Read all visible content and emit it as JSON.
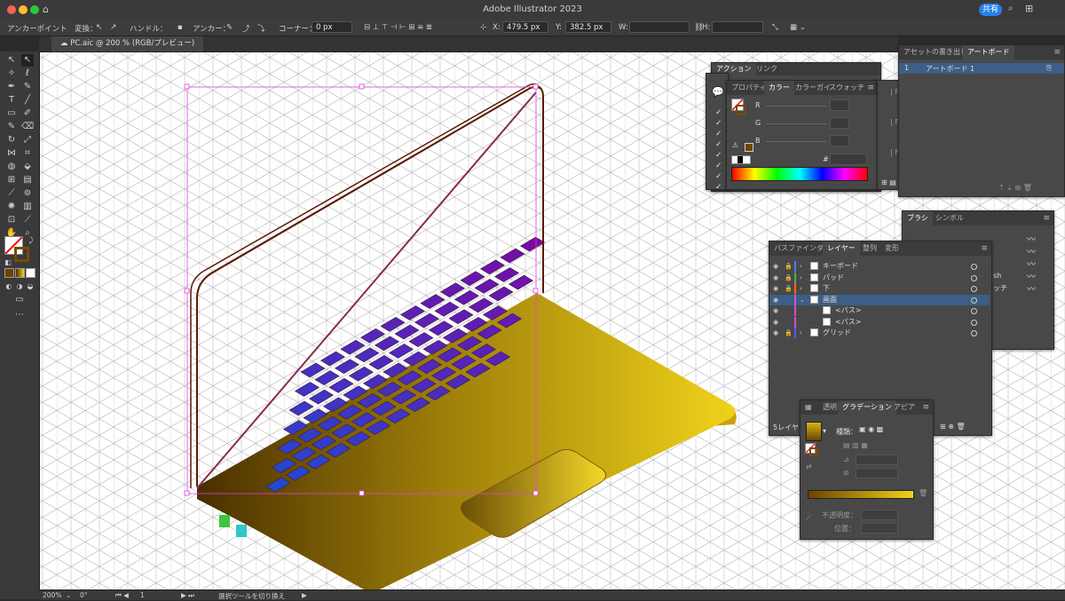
{
  "app": {
    "title": "Adobe Illustrator 2023",
    "share_label": "共有"
  },
  "control_bar": {
    "mode": "アンカーポイント",
    "transform_label": "変換：",
    "handle_label": "ハンドル：",
    "anchor_label": "アンカー：",
    "corner_label": "コーナー：",
    "corner_value": "0 px",
    "x_label": "X:",
    "x_value": "479.5 px",
    "y_label": "Y:",
    "y_value": "382.5 px",
    "w_label": "W:",
    "h_label": "H:"
  },
  "document": {
    "tab_label": "PC.aic @ 200 % (RGB/プレビュー)"
  },
  "status": {
    "zoom": "200%",
    "rotation": "0°",
    "artboard_index": "1",
    "message": "選択ツールを切り換え"
  },
  "actions_panel": {
    "tabs": [
      "アクション",
      "リンク"
    ]
  },
  "color_panel": {
    "tabs": [
      "プロパティ",
      "カラー",
      "カラーガイ",
      "スウォッチ"
    ],
    "channels": [
      "R",
      "G",
      "B"
    ],
    "hex_label": "#"
  },
  "artboards_panel": {
    "tabs": [
      "アセットの書き出し",
      "アートボード"
    ],
    "items": [
      {
        "index": "1",
        "name": "アートボード 1"
      }
    ]
  },
  "brush_panel": {
    "tabs": [
      "ブラシ",
      "シンボル"
    ],
    "peek_texts": [
      "sh",
      "ッチ"
    ]
  },
  "layers_panel": {
    "tabs": [
      "パスファインダー",
      "レイヤー",
      "整列",
      "変形"
    ],
    "rows": [
      {
        "name": "キーボード",
        "color": "#4f7bff"
      },
      {
        "name": "パッド",
        "color": "#4caf50"
      },
      {
        "name": "下",
        "color": "#ff6a00"
      },
      {
        "name": "画面",
        "color": "#d34fd3"
      },
      {
        "name": "<パス>",
        "color": "#d34fd3"
      },
      {
        "name": "<パス>",
        "color": "#d34fd3"
      },
      {
        "name": "グリッド",
        "color": "#6a4fff"
      }
    ],
    "footer": "5レイヤ"
  },
  "gradient_panel": {
    "tabs": [
      "透明",
      "グラデーション",
      "アピア"
    ],
    "type_label": "種類：",
    "opacity_label": "不透明度：",
    "position_label": "位置："
  },
  "colors": {
    "keyboard_top": "#7a0aa5",
    "keyboard_bottom": "#1a4fd6",
    "body_dark": "#4a2f00",
    "body_light": "#f0d21a",
    "selection": "#e040e0"
  }
}
